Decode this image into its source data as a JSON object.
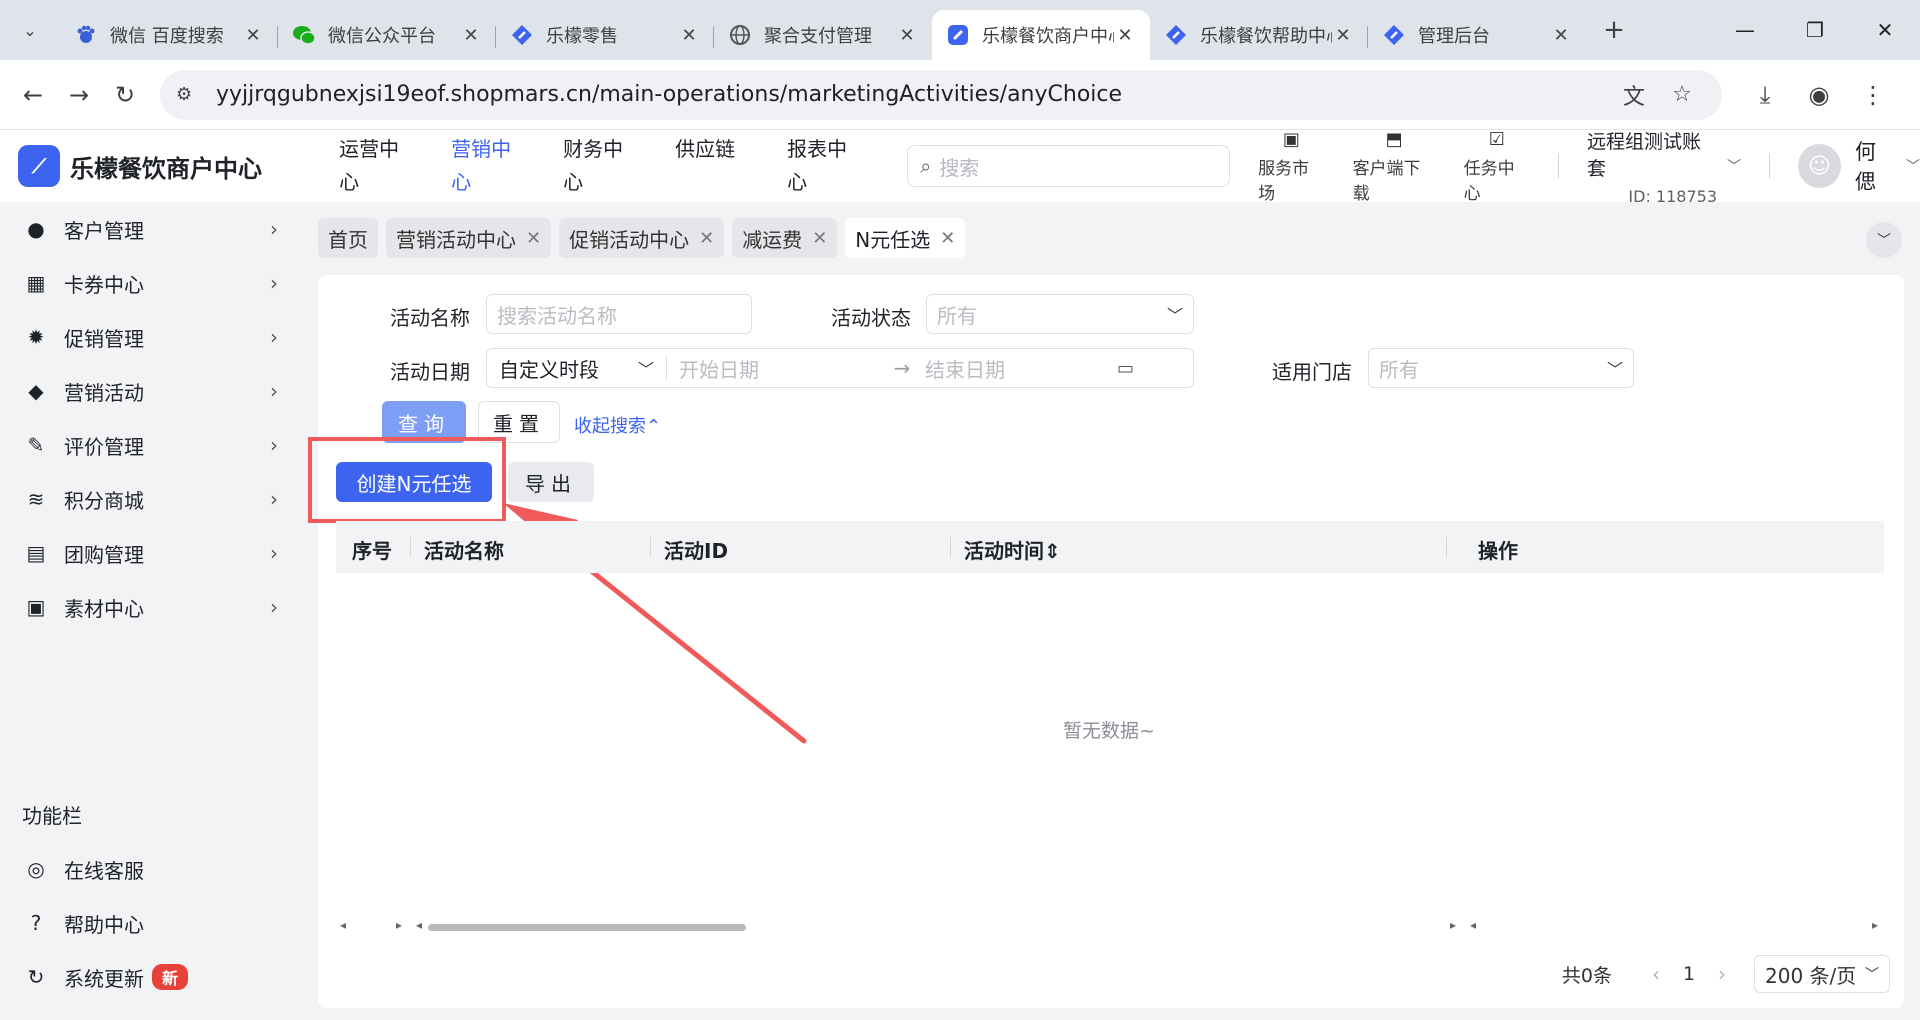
{
  "browser": {
    "tabs": [
      {
        "label": "微信 百度搜索",
        "icon": "baidu-icon",
        "active": false
      },
      {
        "label": "微信公众平台",
        "icon": "wechat-icon",
        "active": false
      },
      {
        "label": "乐檬零售",
        "icon": "lemeng-icon",
        "active": false
      },
      {
        "label": "聚合支付管理",
        "icon": "globe-icon",
        "active": false
      },
      {
        "label": "乐檬餐饮商户中心",
        "icon": "lemeng-icon",
        "active": true
      },
      {
        "label": "乐檬餐饮帮助中心",
        "icon": "lemeng-icon",
        "active": false
      },
      {
        "label": "管理后台",
        "icon": "lemeng-icon",
        "active": false
      }
    ],
    "url": "yyjjrqgubnexjsi19eof.shopmars.cn/main-operations/marketingActivities/anyChoice"
  },
  "header": {
    "logo_text": "乐檬餐饮商户中心",
    "nav": [
      {
        "label": "运营中心",
        "active": false
      },
      {
        "label": "营销中心",
        "active": true
      },
      {
        "label": "财务中心",
        "active": false
      },
      {
        "label": "供应链",
        "active": false
      },
      {
        "label": "报表中心",
        "active": false
      }
    ],
    "search_placeholder": "搜索",
    "tools": [
      {
        "label": "服务市场",
        "icon": "store-icon"
      },
      {
        "label": "客户端下载",
        "icon": "download-folder-icon"
      },
      {
        "label": "任务中心",
        "icon": "clipboard-icon"
      }
    ],
    "account_name": "远程组测试账套",
    "account_id": "ID: 118753",
    "user_name": "何偲"
  },
  "sidebar": {
    "items": [
      {
        "label": "客户管理",
        "icon": "user-icon"
      },
      {
        "label": "卡券中心",
        "icon": "ticket-icon"
      },
      {
        "label": "促销管理",
        "icon": "gear-badge-icon"
      },
      {
        "label": "营销活动",
        "icon": "tag-icon"
      },
      {
        "label": "评价管理",
        "icon": "edit-icon"
      },
      {
        "label": "积分商城",
        "icon": "database-icon"
      },
      {
        "label": "团购管理",
        "icon": "gift-icon"
      },
      {
        "label": "素材中心",
        "icon": "image-icon"
      }
    ],
    "section_title": "功能栏",
    "func_items": [
      {
        "label": "在线客服",
        "icon": "headset-icon"
      },
      {
        "label": "帮助中心",
        "icon": "help-icon"
      },
      {
        "label": "系统更新",
        "icon": "refresh-icon",
        "badge": "新"
      }
    ]
  },
  "page_tabs": [
    {
      "label": "首页",
      "closable": false,
      "active": false
    },
    {
      "label": "营销活动中心",
      "closable": true,
      "active": false
    },
    {
      "label": "促销活动中心",
      "closable": true,
      "active": false
    },
    {
      "label": "减运费",
      "closable": true,
      "active": false
    },
    {
      "label": "N元任选",
      "closable": true,
      "active": true
    }
  ],
  "filters": {
    "activity_name_label": "活动名称",
    "activity_name_placeholder": "搜索活动名称",
    "activity_status_label": "活动状态",
    "activity_status_value": "所有",
    "activity_date_label": "活动日期",
    "date_type_value": "自定义时段",
    "start_date_placeholder": "开始日期",
    "end_date_placeholder": "结束日期",
    "store_label": "适用门店",
    "store_value": "所有",
    "query_button": "查询",
    "reset_button": "重置",
    "collapse_link": "收起搜索"
  },
  "actions": {
    "create_button": "创建N元任选",
    "export_button": "导出"
  },
  "table": {
    "columns": [
      "序号",
      "活动名称",
      "活动ID",
      "活动时间",
      "操作"
    ],
    "empty_text": "暂无数据~"
  },
  "pagination": {
    "total": "共0条",
    "current_page": "1",
    "page_size": "200 条/页"
  },
  "colors": {
    "accent": "#3c64f0",
    "highlight": "#f05a5a"
  }
}
